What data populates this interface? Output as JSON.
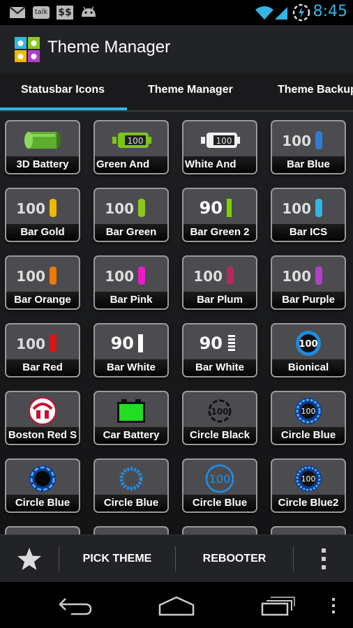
{
  "status_bar": {
    "time": "8:45",
    "talk_label": "talk",
    "dollar_label": "$$",
    "icons": [
      "gmail-icon",
      "talk-icon",
      "dollar-icon",
      "android-icon",
      "wifi-icon",
      "signal-icon",
      "power-saver-icon"
    ]
  },
  "app": {
    "title": "Theme Manager"
  },
  "tabs": [
    {
      "label": "Statusbar Icons",
      "selected": true
    },
    {
      "label": "Theme Manager",
      "selected": false
    },
    {
      "label": "Theme Backup",
      "selected": false
    }
  ],
  "grid": {
    "items": [
      {
        "label": "3D Battery",
        "icon": "battery-3d-green"
      },
      {
        "label": "Green       And",
        "icon": "battery-android-green",
        "value": "100"
      },
      {
        "label": "White       And",
        "icon": "battery-android-white",
        "value": "100"
      },
      {
        "label": "Bar Blue",
        "icon": "bar-blue",
        "value": "100",
        "color": "#2f7bd6"
      },
      {
        "label": "Bar Gold",
        "icon": "bar-gold",
        "value": "100",
        "color": "#f0b800"
      },
      {
        "label": "Bar Green",
        "icon": "bar-green",
        "value": "100",
        "color": "#8cc81c"
      },
      {
        "label": "Bar Green 2",
        "icon": "bar-green-2",
        "value": "90",
        "color": "#7bd400"
      },
      {
        "label": "Bar ICS",
        "icon": "bar-ics",
        "value": "100",
        "color": "#33b5e5"
      },
      {
        "label": "Bar Orange",
        "icon": "bar-orange",
        "value": "100",
        "color": "#f07800"
      },
      {
        "label": "Bar Pink",
        "icon": "bar-pink",
        "value": "100",
        "color": "#e81cc8"
      },
      {
        "label": "Bar Plum",
        "icon": "bar-plum",
        "value": "100",
        "color": "#b42a5a"
      },
      {
        "label": "Bar Purple",
        "icon": "bar-purple",
        "value": "100",
        "color": "#b040c8"
      },
      {
        "label": "Bar Red",
        "icon": "bar-red",
        "value": "100",
        "color": "#dc1414"
      },
      {
        "label": "Bar White",
        "icon": "bar-white",
        "value": "90",
        "color": "#ffffff"
      },
      {
        "label": "Bar White",
        "icon": "bar-white-segmented",
        "value": "90",
        "color": "#ffffff"
      },
      {
        "label": "Bionical",
        "icon": "bionical",
        "value": "100",
        "color": "#1c8cdc"
      },
      {
        "label": "Boston Red S",
        "icon": "boston-red-sox"
      },
      {
        "label": "Car Battery",
        "icon": "car-battery",
        "color": "#22dd22"
      },
      {
        "label": "Circle Black",
        "icon": "circle-black",
        "value": "100"
      },
      {
        "label": "Circle Blue",
        "icon": "circle-blue-glow",
        "value": "100",
        "color": "#2a7de0"
      },
      {
        "label": "Circle Blue",
        "icon": "circle-blue-dark",
        "color": "#2a7de0"
      },
      {
        "label": "Circle Blue",
        "icon": "circle-blue-dotted",
        "color": "#1e90e8"
      },
      {
        "label": "Circle Blue",
        "icon": "circle-blue-ring",
        "value": "100",
        "color": "#1e90e8"
      },
      {
        "label": "Circle Blue2",
        "icon": "circle-blue-2",
        "value": "100",
        "color": "#2a7de0"
      }
    ]
  },
  "bottom_bar": {
    "favorite_icon": "star-icon",
    "pick_theme_label": "PICK THEME",
    "rebooter_label": "REBOOTER",
    "overflow_icon": "overflow-menu-icon"
  },
  "nav_bar": {
    "icons": [
      "back-icon",
      "home-icon",
      "recent-apps-icon",
      "menu-icon"
    ]
  }
}
